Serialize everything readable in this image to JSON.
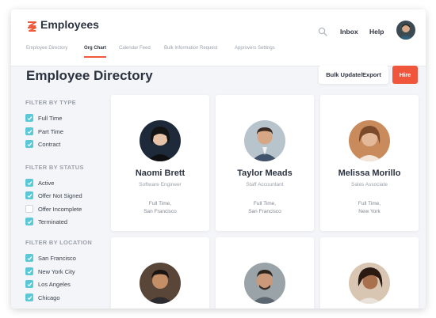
{
  "header": {
    "app_title": "Employees",
    "brand_color": "#ef5a3c",
    "links": {
      "inbox": "Inbox",
      "help": "Help"
    },
    "icons": {
      "logo": "stacked-chevrons-logo",
      "search": "search-icon",
      "avatar": "user-avatar"
    }
  },
  "tabs": [
    {
      "label": "Employee Directory",
      "active": false
    },
    {
      "label": "Org Chart",
      "active": true
    },
    {
      "label": "Calendar Feed",
      "active": false
    },
    {
      "label": "Bulk Information Request",
      "active": false
    },
    {
      "label": "Approvers Settings",
      "active": false
    }
  ],
  "page": {
    "title": "Employee Directory",
    "bulk_button": "Bulk Update/Export",
    "hire_button": "Hire"
  },
  "filters": {
    "type": {
      "heading": "FILTER BY TYPE",
      "options": [
        {
          "label": "Full Time",
          "checked": true
        },
        {
          "label": "Part Time",
          "checked": true
        },
        {
          "label": "Contract",
          "checked": true
        }
      ]
    },
    "status": {
      "heading": "FILTER BY STATUS",
      "options": [
        {
          "label": "Active",
          "checked": true
        },
        {
          "label": "Offer Not Signed",
          "checked": true
        },
        {
          "label": "Offer Incomplete",
          "checked": false
        },
        {
          "label": "Terminated",
          "checked": true
        }
      ]
    },
    "location": {
      "heading": "FILTER BY LOCATION",
      "options": [
        {
          "label": "San Francisco",
          "checked": true
        },
        {
          "label": "New York City",
          "checked": true
        },
        {
          "label": "Los Angeles",
          "checked": true
        },
        {
          "label": "Chicago",
          "checked": true
        }
      ]
    }
  },
  "employees": [
    {
      "name": "Naomi Brett",
      "role": "Software Engineer",
      "type": "Full Time,",
      "location": "San Francisco"
    },
    {
      "name": "Taylor Meads",
      "role": "Staff Accountant",
      "type": "Full Time,",
      "location": "San Francisco"
    },
    {
      "name": "Melissa Morillo",
      "role": "Sales Associate",
      "type": "Full Time,",
      "location": "New York"
    },
    {
      "name": "",
      "role": "",
      "type": "",
      "location": ""
    },
    {
      "name": "",
      "role": "",
      "type": "",
      "location": ""
    },
    {
      "name": "",
      "role": "",
      "type": "",
      "location": ""
    }
  ],
  "colors": {
    "accent": "#ef5a3c",
    "checkbox": "#5cc8d6",
    "background": "#f4f5f8"
  }
}
